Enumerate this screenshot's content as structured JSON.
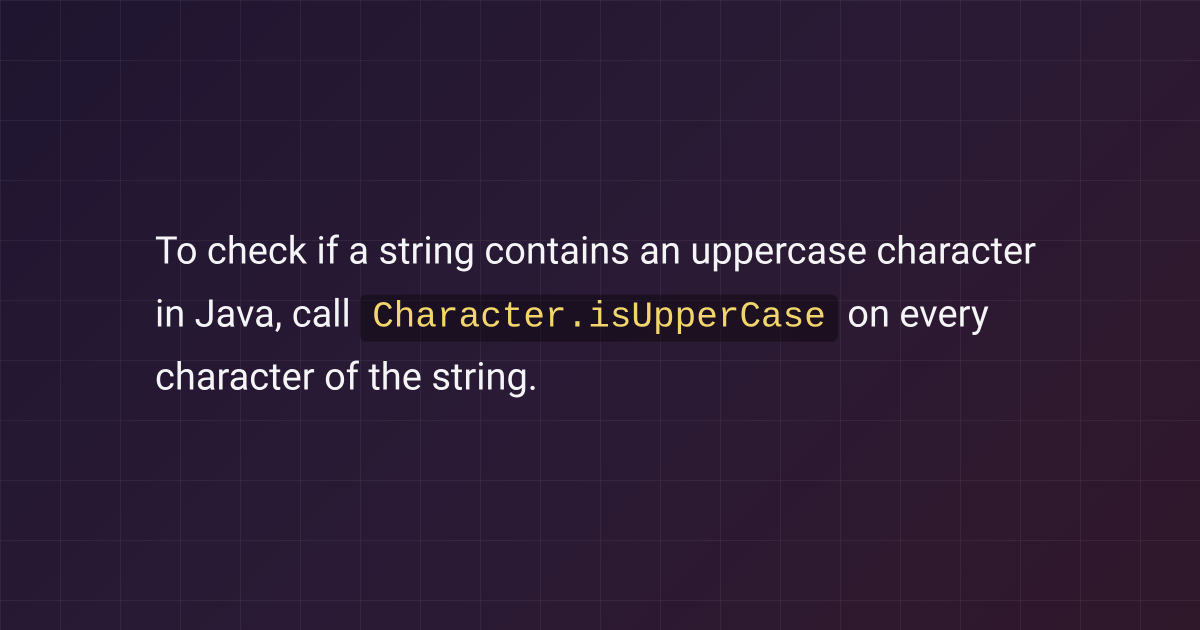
{
  "text": {
    "part1": "To check if a string contains an uppercase character in Java, call ",
    "code": "Character.isUpperCase",
    "part2": " on every character of the string."
  }
}
